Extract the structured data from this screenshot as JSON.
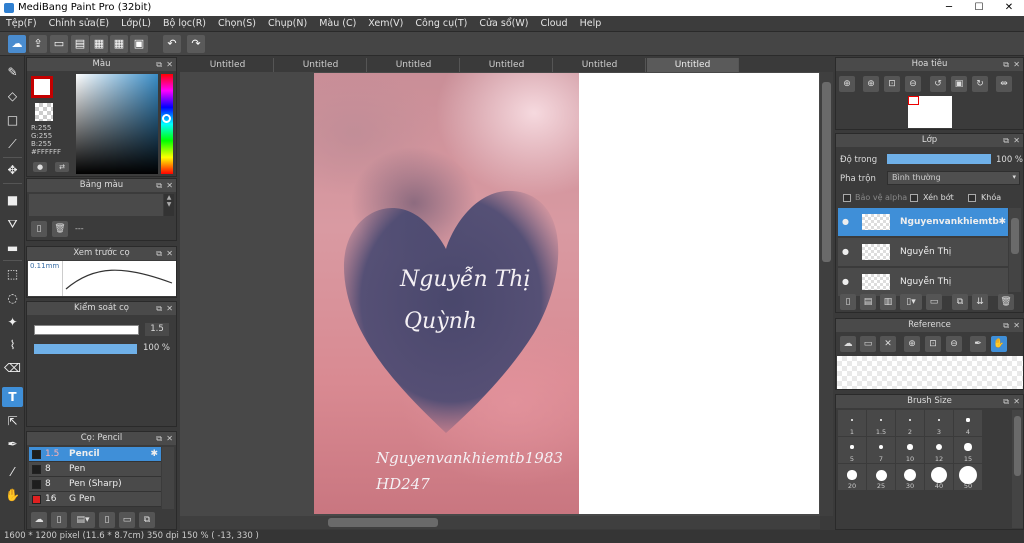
{
  "window": {
    "title": "MediBang Paint Pro (32bit)",
    "minimize": "─",
    "maximize": "☐",
    "close": "✕"
  },
  "menu": [
    "Tệp(F)",
    "Chỉnh sửa(E)",
    "Lớp(L)",
    "Bộ lọc(R)",
    "Chọn(S)",
    "Chụp(N)",
    "Màu (C)",
    "Xem(V)",
    "Công cụ(T)",
    "Cửa sổ(W)",
    "Cloud",
    "Help"
  ],
  "toolbar": {
    "cloud": "☁",
    "share": "⇪",
    "chat": "💬",
    "undo": "↶",
    "redo": "↷"
  },
  "tools": [
    "brush-icon",
    "eraser-icon",
    "rectangle-icon",
    "pen-curve-icon",
    "move-icon",
    "fill-rect-icon",
    "bucket-icon",
    "gradient-icon",
    "select-rect-icon",
    "select-lasso-icon",
    "magic-wand-icon",
    "select-pen-icon",
    "select-erase-icon",
    "text-icon",
    "operation-icon",
    "dropper-icon",
    "divide-icon",
    "hand-icon"
  ],
  "text_tool_label": "T",
  "color_panel": {
    "title": "Màu",
    "r": "R:255",
    "g": "G:255",
    "b": "B:255",
    "hex": "#FFFFFF",
    "primary": "#ffffff"
  },
  "palette_panel": {
    "title": "Bảng màu",
    "dash": "---"
  },
  "brush_preview_panel": {
    "title": "Xem trước cọ",
    "size": "0.11mm"
  },
  "brush_control_panel": {
    "title": "Kiểm soát cọ",
    "size": "1.5",
    "opacity": "100 %"
  },
  "brush_panel": {
    "title": "Cọ: Pencil",
    "items": [
      {
        "size": "1.5",
        "name": "Pencil",
        "color": "#1e1e1e",
        "selected": true
      },
      {
        "size": "8",
        "name": "Pen",
        "color": "#1e1e1e",
        "selected": false
      },
      {
        "size": "8",
        "name": "Pen (Sharp)",
        "color": "#1e1e1e",
        "selected": false
      },
      {
        "size": "16",
        "name": "G Pen",
        "color": "#e02020",
        "selected": false
      }
    ]
  },
  "tabs": [
    "Untitled",
    "Untitled",
    "Untitled",
    "Untitled",
    "Untitled",
    "Untitled"
  ],
  "active_tab": 5,
  "canvas_text": {
    "name_line1": "Nguyễn Thị",
    "name_line2": "Quỳnh",
    "credit_line1": "Nguyenvankhiemtb1983",
    "credit_line2": "HD247"
  },
  "navigator_panel": {
    "title": "Hoa tiêu"
  },
  "layer_panel": {
    "title": "Lớp",
    "opacity_label": "Độ trong",
    "opacity_value": "100 %",
    "blend_label": "Pha trộn",
    "blend_value": "Bình thường",
    "protect_alpha": "Bảo vệ alpha",
    "clip": "Xén bớt",
    "lock": "Khóa",
    "layers": [
      {
        "name": "Nguyenvankhiemtb",
        "selected": true
      },
      {
        "name": "Nguyễn Thị",
        "selected": false
      },
      {
        "name": "Nguyễn Thị",
        "selected": false
      }
    ]
  },
  "reference_panel": {
    "title": "Reference"
  },
  "brush_size_panel": {
    "title": "Brush Size",
    "sizes": [
      "1",
      "1.5",
      "2",
      "3",
      "4",
      "5",
      "7",
      "10",
      "12",
      "15",
      "20",
      "25",
      "30",
      "40",
      "50"
    ]
  },
  "status": "1600 * 1200 pixel   (11.6 * 8.7cm)   350 dpi   150 %   ( -13, 330 )"
}
